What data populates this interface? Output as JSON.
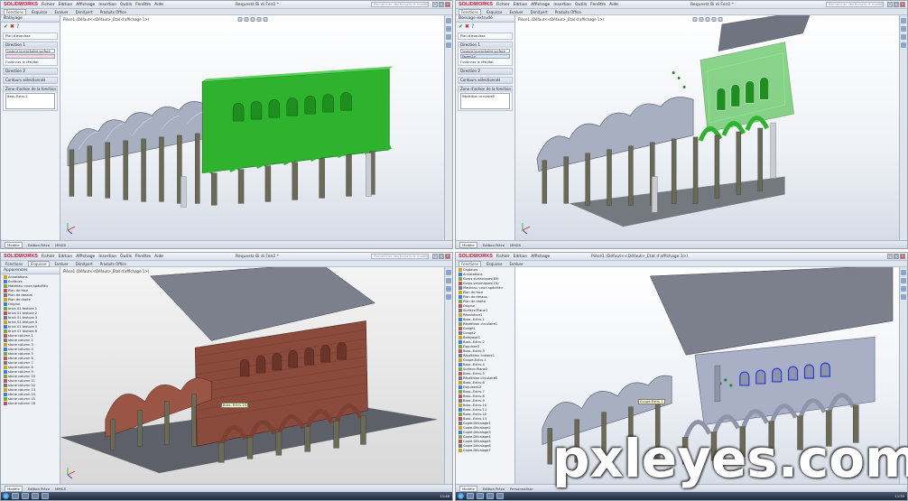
{
  "app": {
    "logo": "SOLIDWORKS",
    "menus": [
      "Fichier",
      "Edition",
      "Affichage",
      "Insertion",
      "Outils",
      "Fenêtre",
      "Aide"
    ],
    "search_placeholder": "Rechercher des fichiers et modèles",
    "cmd_tabs": [
      "Fonctions",
      "Esquisse",
      "Evaluer",
      "DimXpert",
      "Produits Office"
    ]
  },
  "q1": {
    "doc_title": "Requestz Bi di Fen2 *",
    "pm_title": "Balayage",
    "pm_row_1": "Plan d'esquisse",
    "section_direction": "Direction 1",
    "section_direction_value": "Jusqu'à la prochaine surface",
    "row_merge": "Fusionner le résultat",
    "section_thin": "Direction 2",
    "section_contours": "Contours sélectionnés",
    "section_feature": "Zone d'action de la fonction",
    "list_value": "Boss.-Extru.2",
    "viewport_label": "Pièce1 (Défaut<<Défaut>_Etat d'affichage 1>)",
    "status": [
      "Modèle",
      "Edition Pièce",
      "MMGS"
    ]
  },
  "q2": {
    "doc_title": "Requestz Bi di Fen2 *",
    "pm_title": "Bossage extrudé",
    "pm_row_1": "Plan d'esquisse",
    "section_direction": "Direction 1",
    "section_direction_value": "Jusqu'à la prochaine surface",
    "sel_value": "Face<1>",
    "row_merge": "Fusionner le résultat",
    "section_thin": "Direction 2",
    "section_contours": "Contours sélectionnés",
    "section_feature": "Zone d'action de la fonction",
    "list_value": "Répétition circulaire2",
    "viewport_label": "Pièce1 (Défaut<<Défaut>_Etat d'affichage 1>)",
    "status": [
      "Modèle",
      "Edition Pièce",
      "MMGS"
    ]
  },
  "q3": {
    "doc_title": "Requestz Bi di Fen2 *",
    "pm_title": "Apparences",
    "tree_items": [
      "Annotations",
      "Surfaces",
      "Matériau <non spécifié>",
      "Plan de face",
      "Plan de dessus",
      "Plan de droite",
      "Origine",
      "brick 01 texture 1",
      "brick 01 texture 2",
      "brick 01 texture 3",
      "brick 01 texture 4",
      "brick 01 texture 5",
      "brick 01 texture 6",
      "stone column 1",
      "stone column 2",
      "stone column 3",
      "stone column 4",
      "stone column 5",
      "stone column 6",
      "stone column 7",
      "stone column 8",
      "stone column 9",
      "stone column 10",
      "stone column 11",
      "stone column 12",
      "stone column 13",
      "stone column 14",
      "stone column 15",
      "stone column 16"
    ],
    "callout": "Boss.-Extru.20",
    "viewport_label": "Pièce1 (Défaut<<Défaut>_Etat d'affichage 1>)",
    "status": [
      "Modèle",
      "Edition Pièce",
      "MMGS"
    ],
    "clock": "11:46"
  },
  "q4": {
    "doc_title": "Pièce1 (Défaut<<Défaut>_Etat d'affichage 1>)",
    "tree_items": [
      "Capteurs",
      "Annotations",
      "Corps surfaciques(89)",
      "Corps volumiques(16)",
      "Matériau <non spécifié>",
      "Plan de face",
      "Plan de dessus",
      "Plan de droite",
      "Origine",
      "Surface-Plane1",
      "Révolution1",
      "Boss.-Extru.1",
      "Répétition circulaire1",
      "Congé1",
      "Congé2",
      "Balayage1",
      "Boss.-Extru.2",
      "Esquisse3",
      "Boss.-Extru.3",
      "Répétition linéaire1",
      "Coupe-Extru.1",
      "Boss.-Extru.4",
      "Surface-Plane2",
      "Boss.-Extru.5",
      "Répétition circulaire2",
      "Boss.-Extru.6",
      "Esquisse12",
      "Boss.-Extru.7",
      "Boss.-Extru.8",
      "Boss.-Extru.9",
      "Boss.-Extru.10",
      "Boss.-Extru.11",
      "Boss.-Extru.12",
      "Boss.-Extru.13",
      "Copie-Décalage1",
      "Copie-Décalage2",
      "Copie-Décalage3",
      "Copie-Décalage4",
      "Copie-Décalage5",
      "Copie-Décalage6",
      "Copie-Décalage7"
    ],
    "callout": "Coupe-Extru.1",
    "status": [
      "Modèle",
      "Edition Pièce",
      "Personnaliser"
    ],
    "clock": "11:52"
  },
  "watermark": "pxleyes.com",
  "colors": {
    "green_wall": "#2fb32f",
    "green_dark": "#1e7d1e",
    "column": "#6b6a58",
    "vault": "#8a93a6",
    "brick": "#8a4a3c",
    "roof": "#7b808c",
    "floor": "#5d6068"
  }
}
